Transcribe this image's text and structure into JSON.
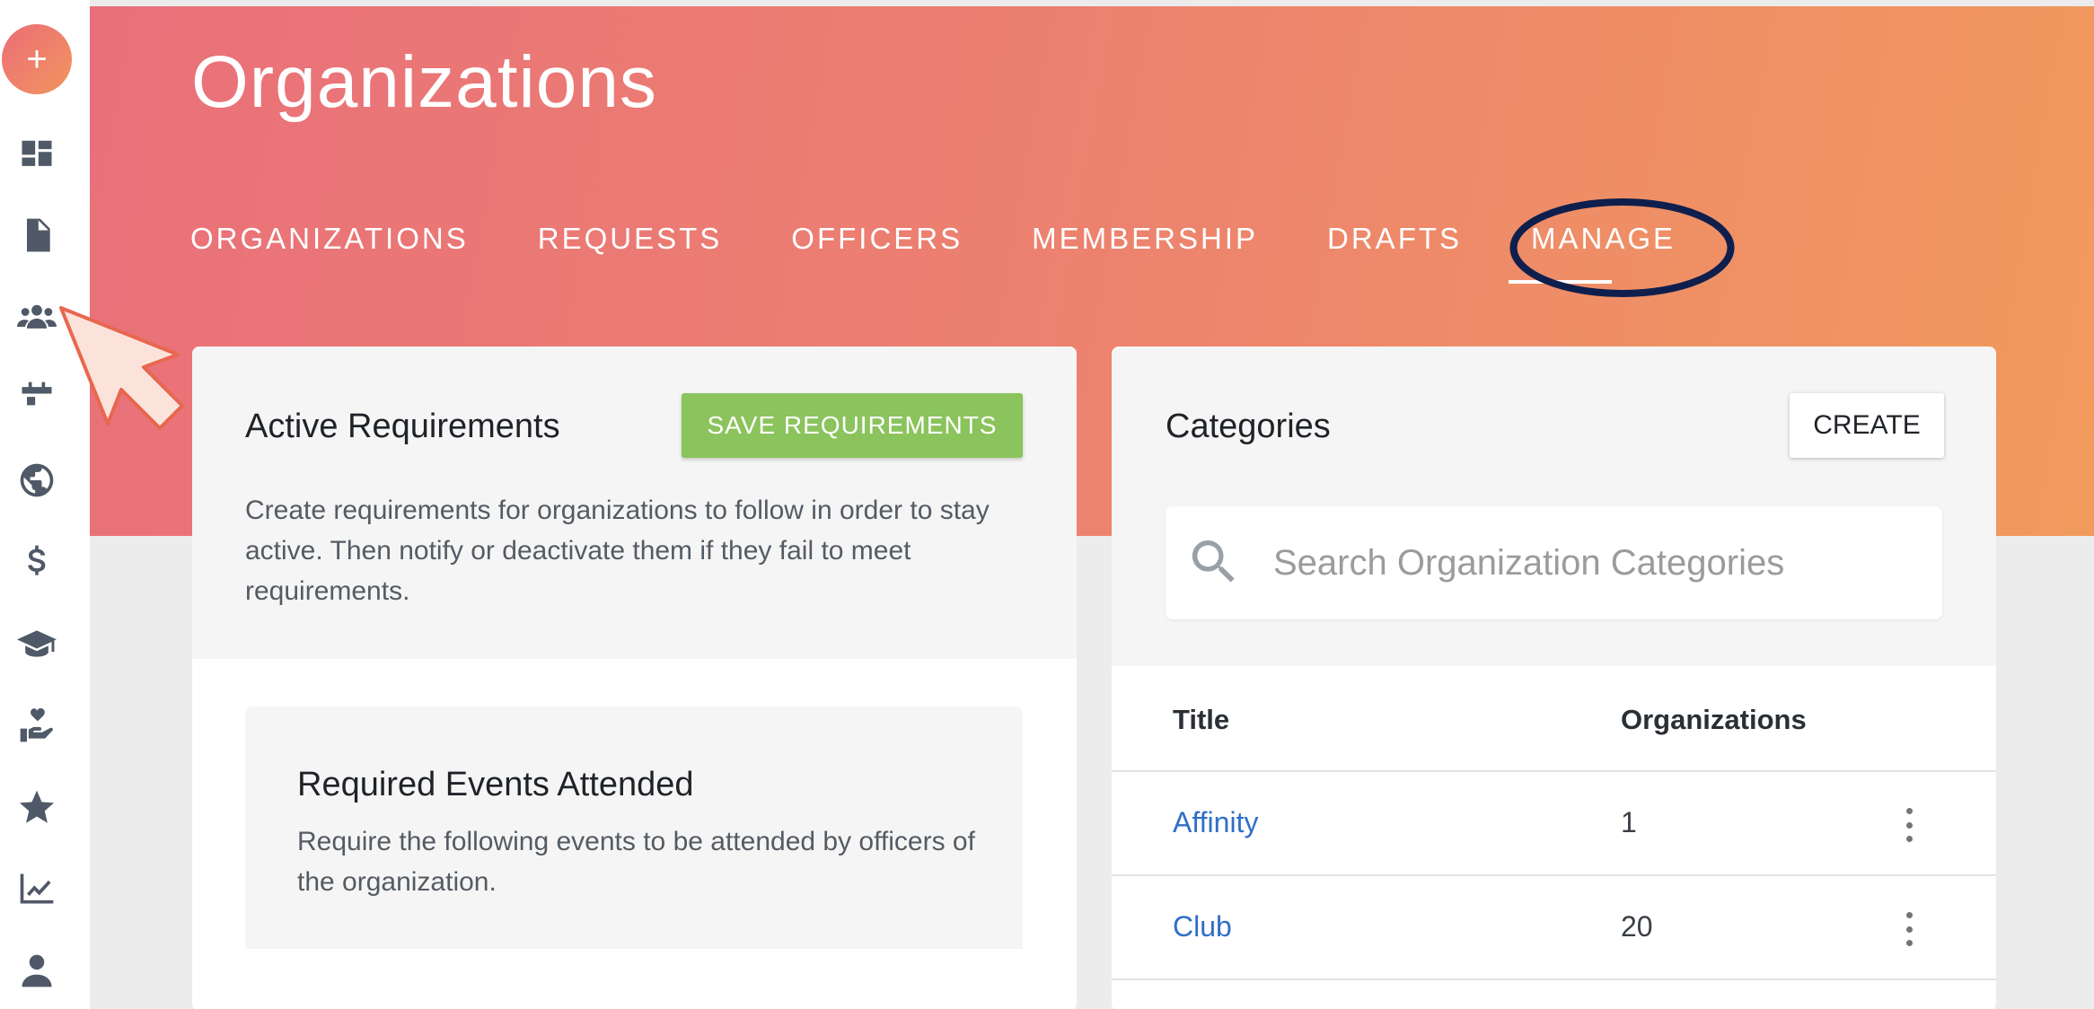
{
  "app": {
    "new_button_label": "+"
  },
  "sidebar": {
    "items": [
      {
        "icon": "dashboard-icon"
      },
      {
        "icon": "document-icon"
      },
      {
        "icon": "groups-icon"
      },
      {
        "icon": "calendar-icon"
      },
      {
        "icon": "globe-icon"
      },
      {
        "icon": "dollar-icon"
      },
      {
        "icon": "graduation-cap-icon"
      },
      {
        "icon": "hand-heart-icon"
      },
      {
        "icon": "star-icon"
      },
      {
        "icon": "chart-icon"
      },
      {
        "icon": "person-icon"
      }
    ]
  },
  "header": {
    "title": "Organizations",
    "tabs": [
      {
        "label": "ORGANIZATIONS"
      },
      {
        "label": "REQUESTS"
      },
      {
        "label": "OFFICERS"
      },
      {
        "label": "MEMBERSHIP"
      },
      {
        "label": "DRAFTS"
      },
      {
        "label": "MANAGE",
        "active": true
      }
    ]
  },
  "requirements": {
    "title": "Active Requirements",
    "save_label": "SAVE REQUIREMENTS",
    "description": "Create requirements for organizations to follow in order to stay active. Then notify or deactivate them if they fail to meet requirements.",
    "events_card": {
      "title": "Required Events Attended",
      "description": "Require the following events to be attended by officers of the organization."
    }
  },
  "categories": {
    "title": "Categories",
    "create_label": "CREATE",
    "search_placeholder": "Search Organization Categories",
    "columns": {
      "title": "Title",
      "organizations": "Organizations"
    },
    "rows": [
      {
        "title": "Affinity",
        "count": "1"
      },
      {
        "title": "Club",
        "count": "20"
      }
    ]
  },
  "colors": {
    "header_gradient_start": "#e9707a",
    "header_gradient_end": "#f19a5d",
    "save_button": "#8bc35c",
    "link": "#2f6fc6",
    "highlight_ring": "#0f1f4d"
  }
}
